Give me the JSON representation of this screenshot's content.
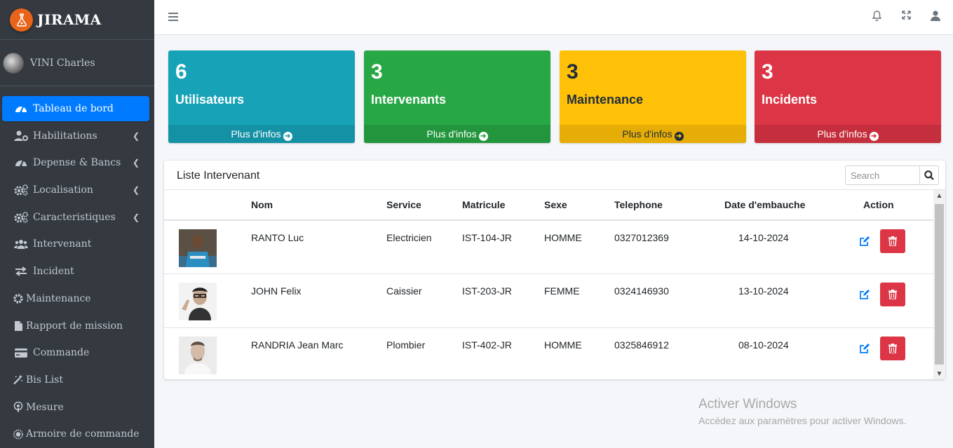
{
  "brand": {
    "name": "JIRAMA",
    "logo": "jirama-logo-icon"
  },
  "user": {
    "name": "VINI Charles"
  },
  "sidebar": {
    "items": [
      {
        "label": "Tableau de bord",
        "icon": "tachometer-icon",
        "active": true
      },
      {
        "label": "Habilitations",
        "icon": "user-gear-icon",
        "has_children": true
      },
      {
        "label": "Depense & Bancs",
        "icon": "tachometer-icon",
        "has_children": true
      },
      {
        "label": "Localisation",
        "icon": "cogs-icon",
        "has_children": true
      },
      {
        "label": "Caracteristiques",
        "icon": "cogs-icon",
        "has_children": true
      },
      {
        "label": "Intervenant",
        "icon": "users-icon"
      },
      {
        "label": "Incident",
        "icon": "exchange-icon"
      },
      {
        "label": "Maintenance",
        "icon": "gear-icon"
      },
      {
        "label": "Rapport de mission",
        "icon": "file-icon"
      },
      {
        "label": "Commande",
        "icon": "credit-card-icon"
      },
      {
        "label": "Bis List",
        "icon": "magic-wand-icon"
      },
      {
        "label": "Mesure",
        "icon": "podcast-icon"
      },
      {
        "label": "Armoire de commande",
        "icon": "sun-icon"
      }
    ]
  },
  "header": {
    "icons": [
      "bars-icon",
      "bell-icon",
      "expand-icon",
      "user-icon"
    ]
  },
  "stats": [
    {
      "value": "6",
      "label": "Utilisateurs",
      "link": "Plus d'infos",
      "color": "#17a2b8"
    },
    {
      "value": "3",
      "label": "Intervenants",
      "link": "Plus d'infos",
      "color": "#28a745"
    },
    {
      "value": "3",
      "label": "Maintenance",
      "link": "Plus d'infos",
      "color": "#ffc107"
    },
    {
      "value": "3",
      "label": "Incidents",
      "link": "Plus d'infos",
      "color": "#dc3545"
    }
  ],
  "card": {
    "title": "Liste Intervenant",
    "search_placeholder": "Search",
    "columns": [
      "",
      "Nom",
      "Service",
      "Matricule",
      "Sexe",
      "Telephone",
      "Date d'embauche",
      "Action"
    ],
    "rows": [
      {
        "nom": "RANTO Luc",
        "service": "Electricien",
        "matricule": "IST-104-JR",
        "sexe": "HOMME",
        "telephone": "0327012369",
        "date": "14-10-2024"
      },
      {
        "nom": "JOHN Felix",
        "service": "Caissier",
        "matricule": "IST-203-JR",
        "sexe": "FEMME",
        "telephone": "0324146930",
        "date": "13-10-2024"
      },
      {
        "nom": "RANDRIA Jean Marc",
        "service": "Plombier",
        "matricule": "IST-402-JR",
        "sexe": "HOMME",
        "telephone": "0325846912",
        "date": "08-10-2024"
      }
    ]
  },
  "watermark": {
    "line1": "Activer Windows",
    "line2": "Accédez aux paramètres pour activer Windows."
  }
}
